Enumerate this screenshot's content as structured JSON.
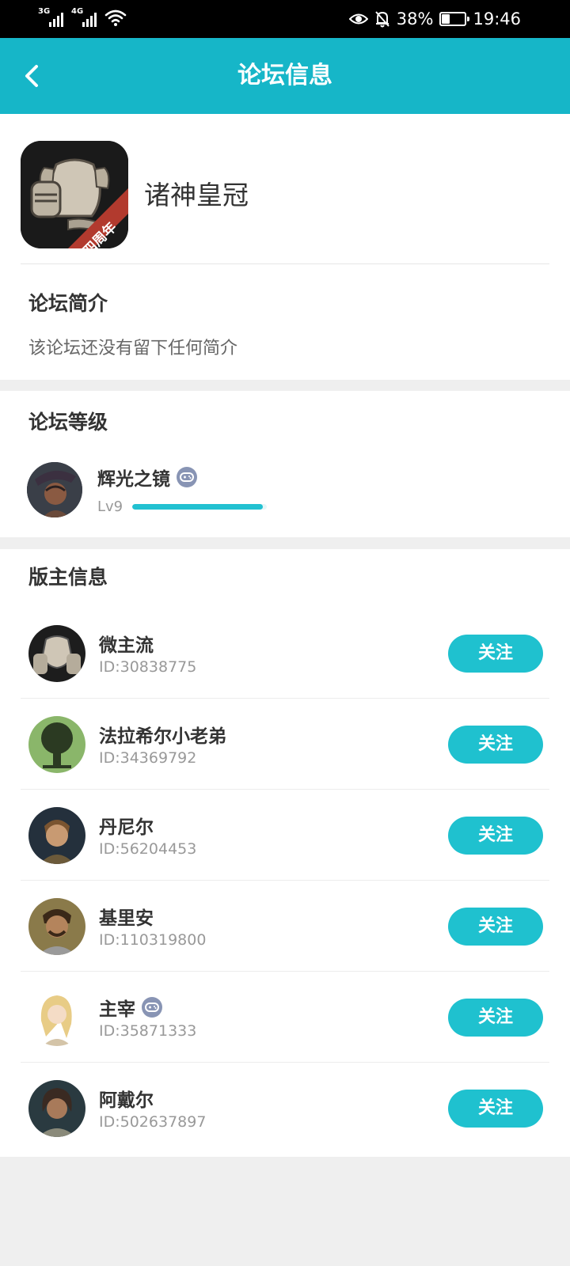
{
  "status_bar": {
    "network1": "3G",
    "network2": "4G",
    "battery_percent": "38%",
    "battery_level": 0.38,
    "time": "19:46",
    "icons": [
      "signal-icon",
      "signal-icon",
      "wifi-icon",
      "eye-icon",
      "bell-off-icon",
      "battery-icon"
    ]
  },
  "header": {
    "title": "论坛信息",
    "back_icon": "chevron-left-icon"
  },
  "forum": {
    "name": "诸神皇冠",
    "logo_badge": "四周年",
    "intro_title": "论坛简介",
    "intro_text": "该论坛还没有留下任何简介"
  },
  "level": {
    "section_title": "论坛等级",
    "name": "辉光之镜",
    "badge_icon": "gamepad-icon",
    "level_label": "Lv9",
    "progress": 0.97
  },
  "moderators": {
    "section_title": "版主信息",
    "items": [
      {
        "name": "微主流",
        "id": "ID:30838775",
        "badge": false,
        "follow": "关注"
      },
      {
        "name": "法拉希尔小老弟",
        "id": "ID:34369792",
        "badge": false,
        "follow": "关注"
      },
      {
        "name": "丹尼尔",
        "id": "ID:56204453",
        "badge": false,
        "follow": "关注"
      },
      {
        "name": "基里安",
        "id": "ID:110319800",
        "badge": false,
        "follow": "关注"
      },
      {
        "name": "主宰",
        "id": "ID:35871333",
        "badge": true,
        "follow": "关注"
      },
      {
        "name": "阿戴尔",
        "id": "ID:502637897",
        "badge": false,
        "follow": "关注"
      }
    ]
  },
  "colors": {
    "accent": "#16b6c8",
    "button": "#1fc1cf",
    "badge": "#8894b4"
  }
}
